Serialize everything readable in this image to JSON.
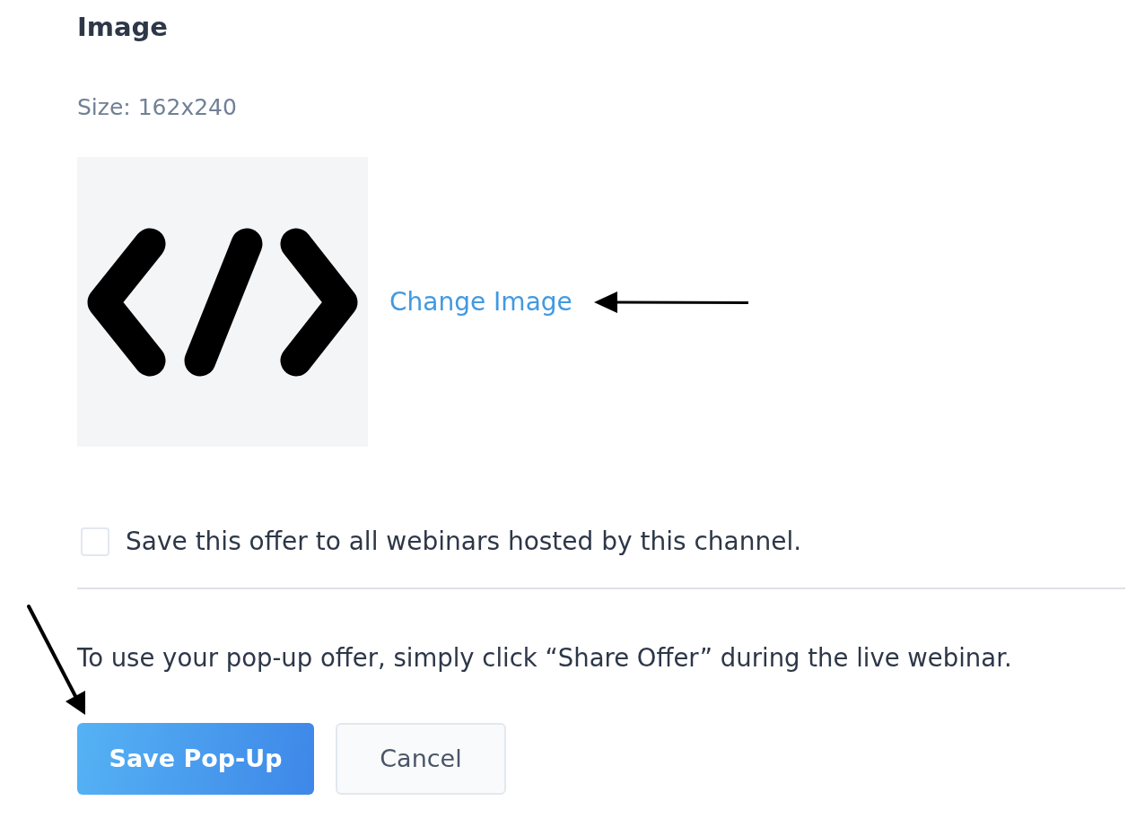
{
  "section": {
    "title": "Image",
    "size_note": "Size: 162x240"
  },
  "image": {
    "link": "Change Image"
  },
  "save_to_all": {
    "label": "Save this offer to all webinars hosted by this channel.",
    "checked": false
  },
  "note": "To use your pop-up offer, simply click “Share Offer” during the live webinar.",
  "buttons": [
    {
      "label": "Save Pop-Up",
      "kind": "primary"
    },
    {
      "label": "Cancel",
      "kind": "secondary"
    }
  ]
}
